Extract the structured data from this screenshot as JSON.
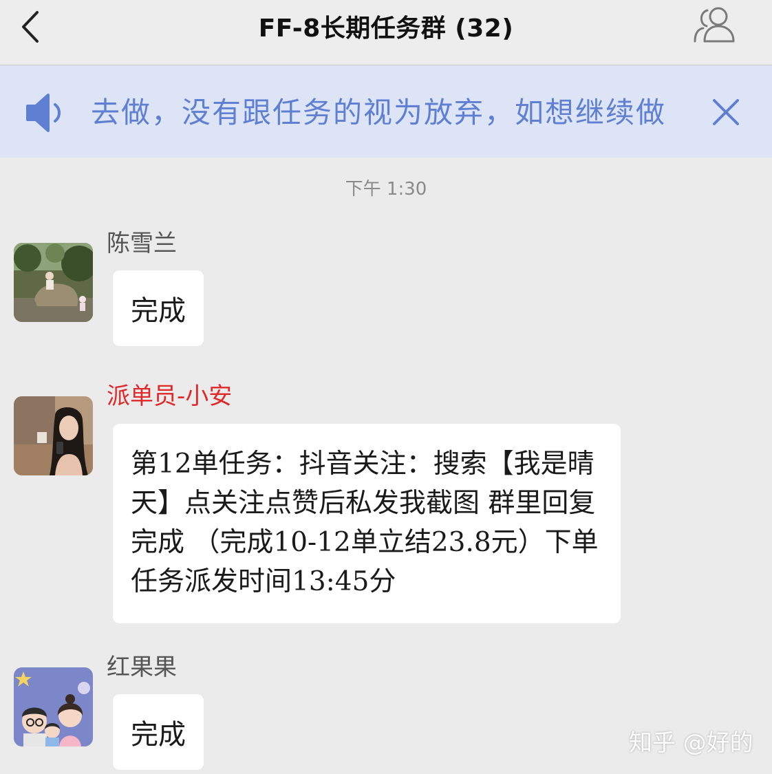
{
  "header": {
    "title": "FF-8长期任务群 (32)",
    "back_icon": "chevron-left-icon",
    "members_icon": "group-members-icon"
  },
  "notice": {
    "text": "去做，没有跟任务的视为放弃，如想继续做",
    "speaker_icon": "speaker-icon",
    "close_icon": "close-icon",
    "text_color": "#5f7fd3",
    "background": "#dce4f5"
  },
  "chat": {
    "timestamp": "下午 1:30",
    "messages": [
      {
        "sender": "陈雪兰",
        "text": "完成",
        "avatar": "avatar-photo"
      },
      {
        "sender": "派单员-小安",
        "sender_color": "#e02828",
        "text": "第12单任务：抖音关注：搜索【我是晴天】点关注点赞后私发我截图  群里回复完成  （完成10-12单立结23.8元）下单任务派发时间13:45分",
        "avatar": "avatar-photo"
      },
      {
        "sender": "红果果",
        "text": "完成",
        "avatar": "avatar-cartoon"
      }
    ]
  },
  "watermark": "知乎 @好的"
}
